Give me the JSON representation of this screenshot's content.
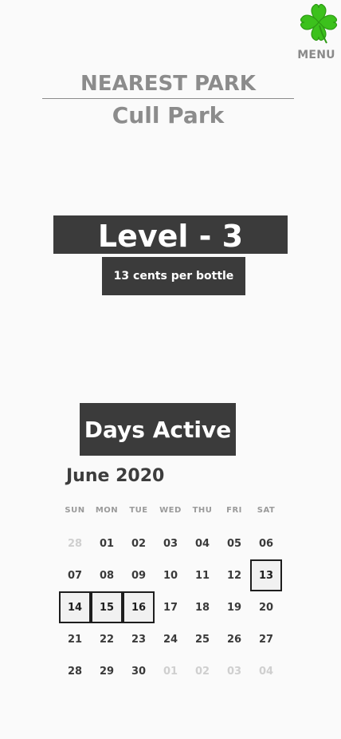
{
  "menu": {
    "label": "MENU",
    "icon": "clover-icon",
    "icon_color": "#3cc11c"
  },
  "park": {
    "label": "NEAREST PARK",
    "name": "Cull Park"
  },
  "level": {
    "title": "Level - 3",
    "rate": "13 cents per bottle"
  },
  "days_active": {
    "title": "Days Active"
  },
  "calendar": {
    "month_label": "June 2020",
    "weekdays": [
      "SUN",
      "MON",
      "TUE",
      "WED",
      "THU",
      "FRI",
      "SAT"
    ],
    "days": [
      {
        "label": "28",
        "in_month": false,
        "active": false
      },
      {
        "label": "01",
        "in_month": true,
        "active": false
      },
      {
        "label": "02",
        "in_month": true,
        "active": false
      },
      {
        "label": "03",
        "in_month": true,
        "active": false
      },
      {
        "label": "04",
        "in_month": true,
        "active": false
      },
      {
        "label": "05",
        "in_month": true,
        "active": false
      },
      {
        "label": "06",
        "in_month": true,
        "active": false
      },
      {
        "label": "07",
        "in_month": true,
        "active": false
      },
      {
        "label": "08",
        "in_month": true,
        "active": false
      },
      {
        "label": "09",
        "in_month": true,
        "active": false
      },
      {
        "label": "10",
        "in_month": true,
        "active": false
      },
      {
        "label": "11",
        "in_month": true,
        "active": false
      },
      {
        "label": "12",
        "in_month": true,
        "active": false
      },
      {
        "label": "13",
        "in_month": true,
        "active": true
      },
      {
        "label": "14",
        "in_month": true,
        "active": true
      },
      {
        "label": "15",
        "in_month": true,
        "active": true
      },
      {
        "label": "16",
        "in_month": true,
        "active": true
      },
      {
        "label": "17",
        "in_month": true,
        "active": false
      },
      {
        "label": "18",
        "in_month": true,
        "active": false
      },
      {
        "label": "19",
        "in_month": true,
        "active": false
      },
      {
        "label": "20",
        "in_month": true,
        "active": false
      },
      {
        "label": "21",
        "in_month": true,
        "active": false
      },
      {
        "label": "22",
        "in_month": true,
        "active": false
      },
      {
        "label": "23",
        "in_month": true,
        "active": false
      },
      {
        "label": "24",
        "in_month": true,
        "active": false
      },
      {
        "label": "25",
        "in_month": true,
        "active": false
      },
      {
        "label": "26",
        "in_month": true,
        "active": false
      },
      {
        "label": "27",
        "in_month": true,
        "active": false
      },
      {
        "label": "28",
        "in_month": true,
        "active": false
      },
      {
        "label": "29",
        "in_month": true,
        "active": false
      },
      {
        "label": "30",
        "in_month": true,
        "active": false
      },
      {
        "label": "01",
        "in_month": false,
        "active": false
      },
      {
        "label": "02",
        "in_month": false,
        "active": false
      },
      {
        "label": "03",
        "in_month": false,
        "active": false
      },
      {
        "label": "04",
        "in_month": false,
        "active": false
      }
    ]
  }
}
